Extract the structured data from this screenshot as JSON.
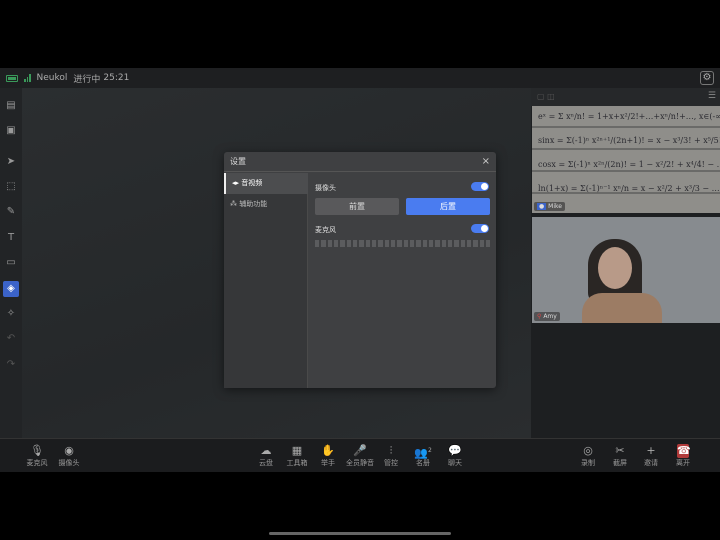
{
  "status": {
    "name": "Neukol",
    "state": "进行中",
    "time": "25:21",
    "icons": [
      "battery-icon",
      "signal-icon"
    ]
  },
  "settings_icon": "gear-icon",
  "left_tools": [
    "chat-icon",
    "screen-share-icon",
    "pointer-icon",
    "select-icon",
    "pen-icon",
    "text-icon",
    "image-icon",
    "eraser-icon",
    "laser-icon",
    "undo-icon",
    "redo-icon"
  ],
  "videos": {
    "tile1_name": "Mike",
    "tile2_name": "Amy",
    "formulas": [
      "eˣ = Σ xⁿ/n! = 1+x+x²/2!+…+xⁿ/n!+…, x∈(-∞",
      "sinx = Σ(-1)ⁿ x²ⁿ⁺¹/(2n+1)! = x − x³/3! + x⁵/5! − …, x∈(-∞",
      "cosx = Σ(-1)ⁿ x²ⁿ/(2n)! = 1 − x²/2! + x⁴/4! − …, x∈(-∞",
      "ln(1+x) = Σ(-1)ⁿ⁻¹ xⁿ/n = x − x²/2 + x³/3 − …, x∈(-1,1"
    ]
  },
  "dialog": {
    "title": "设置",
    "close": "×",
    "side": [
      {
        "label": "音视频",
        "icon": "audio-video-icon"
      },
      {
        "label": "辅助功能",
        "icon": "accessibility-icon"
      }
    ],
    "camera": {
      "label": "摄像头",
      "enabled": true,
      "front": "前置",
      "back": "后置",
      "selected": "后置"
    },
    "mic": {
      "label": "麦克风",
      "enabled": true,
      "level": 0
    },
    "accent": "#4a7cf0"
  },
  "bottom": {
    "left": [
      {
        "label": "麦克风",
        "icon": "mic-icon"
      },
      {
        "label": "摄像头",
        "icon": "camera-icon"
      }
    ],
    "center": [
      {
        "label": "云盘",
        "icon": "cloud-icon"
      },
      {
        "label": "工具箱",
        "icon": "toolbox-icon"
      },
      {
        "label": "举手",
        "icon": "raise-hand-icon"
      },
      {
        "label": "全员静音",
        "icon": "mute-all-icon"
      },
      {
        "label": "管控",
        "icon": "controls-icon"
      },
      {
        "label": "名册",
        "icon": "roster-icon",
        "badge": "2"
      },
      {
        "label": "聊天",
        "icon": "chat-icon"
      }
    ],
    "right": [
      {
        "label": "录制",
        "icon": "record-icon"
      },
      {
        "label": "截屏",
        "icon": "screenshot-icon"
      },
      {
        "label": "邀请",
        "icon": "invite-icon"
      },
      {
        "label": "离开",
        "icon": "leave-icon"
      }
    ]
  }
}
